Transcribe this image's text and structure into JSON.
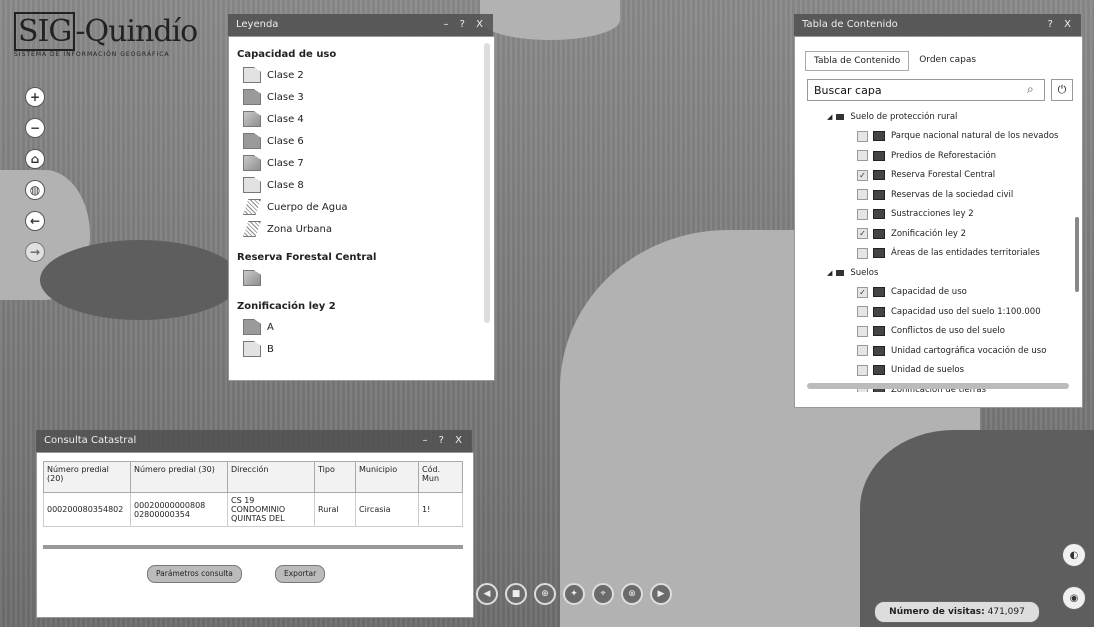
{
  "logo": {
    "title_box": "SIG",
    "title_rest": "-Quindío",
    "subtitle": "SISTEMA DE INFORMACIÓN GEOGRÁFICA"
  },
  "tools": [
    {
      "name": "zoom-in-icon",
      "glyph": "+"
    },
    {
      "name": "zoom-out-icon",
      "glyph": "−"
    },
    {
      "name": "home-icon",
      "glyph": "⌂"
    },
    {
      "name": "globe-icon",
      "glyph": "◍"
    },
    {
      "name": "back-arrow-icon",
      "glyph": "←"
    },
    {
      "name": "forward-arrow-icon",
      "glyph": "→"
    }
  ],
  "legend": {
    "title": "Leyenda",
    "controls": "– ? X",
    "sections": [
      {
        "title": "Capacidad de uso",
        "items": [
          {
            "label": "Clase 2",
            "style": "light"
          },
          {
            "label": "Clase 3",
            "style": "mid"
          },
          {
            "label": "Clase 4",
            "style": ""
          },
          {
            "label": "Clase 6",
            "style": "mid"
          },
          {
            "label": "Clase 7",
            "style": ""
          },
          {
            "label": "Clase 8",
            "style": "light"
          },
          {
            "label": "Cuerpo de Agua",
            "style": "hatch"
          },
          {
            "label": "Zona Urbana",
            "style": "hatch"
          }
        ]
      },
      {
        "title": "Reserva Forestal Central",
        "items": [
          {
            "label": "",
            "style": ""
          }
        ]
      },
      {
        "title": "Zonificación ley 2",
        "items": [
          {
            "label": "A",
            "style": "mid"
          },
          {
            "label": "B",
            "style": "light"
          }
        ]
      }
    ]
  },
  "toc": {
    "title": "Tabla de Contenido",
    "controls": "? X",
    "tabs": [
      "Tabla de Contenido",
      "Orden capas"
    ],
    "search_placeholder": "Buscar capa",
    "search_icon": "⌕",
    "power_icon": "⏻",
    "groups": [
      {
        "label": "Suelo de protección rural",
        "layers": [
          {
            "label": "Parque nacional natural de los nevados",
            "checked": false
          },
          {
            "label": "Predios de Reforestación",
            "checked": false
          },
          {
            "label": "Reserva Forestal Central",
            "checked": true
          },
          {
            "label": "Reservas de la sociedad civil",
            "checked": false
          },
          {
            "label": "Sustracciones ley 2",
            "checked": false
          },
          {
            "label": "Zonificación ley 2",
            "checked": true
          },
          {
            "label": "Áreas de las entidades territoriales",
            "checked": false
          }
        ]
      },
      {
        "label": "Suelos",
        "layers": [
          {
            "label": "Capacidad de uso",
            "checked": true
          },
          {
            "label": "Capacidad uso del suelo 1:100.000",
            "checked": false
          },
          {
            "label": "Conflictos de uso del suelo",
            "checked": false
          },
          {
            "label": "Unidad cartográfica vocación de uso",
            "checked": false
          },
          {
            "label": "Unidad de suelos",
            "checked": false
          },
          {
            "label": "Zonificación de tierras",
            "checked": false
          }
        ]
      }
    ]
  },
  "cadastral": {
    "title": "Consulta Catastral",
    "controls": "– ? X",
    "columns": [
      "Número predial (20)",
      "Número predial (30)",
      "Dirección",
      "Tipo",
      "Municipio",
      "Cód. Mun"
    ],
    "row": [
      "000200080354802",
      "00020000000808 02800000354",
      "CS 19 CONDOMINIO QUINTAS DEL",
      "Rural",
      "Circasia",
      "1!"
    ],
    "btn_params": "Parámetros consulta",
    "btn_export": "Exportar"
  },
  "bottom_tools": [
    "◀",
    "■",
    "⊕",
    "✦",
    "⌖",
    "⊗",
    "▶"
  ],
  "visits": {
    "label": "Número de visitas:",
    "value": "471,097"
  }
}
